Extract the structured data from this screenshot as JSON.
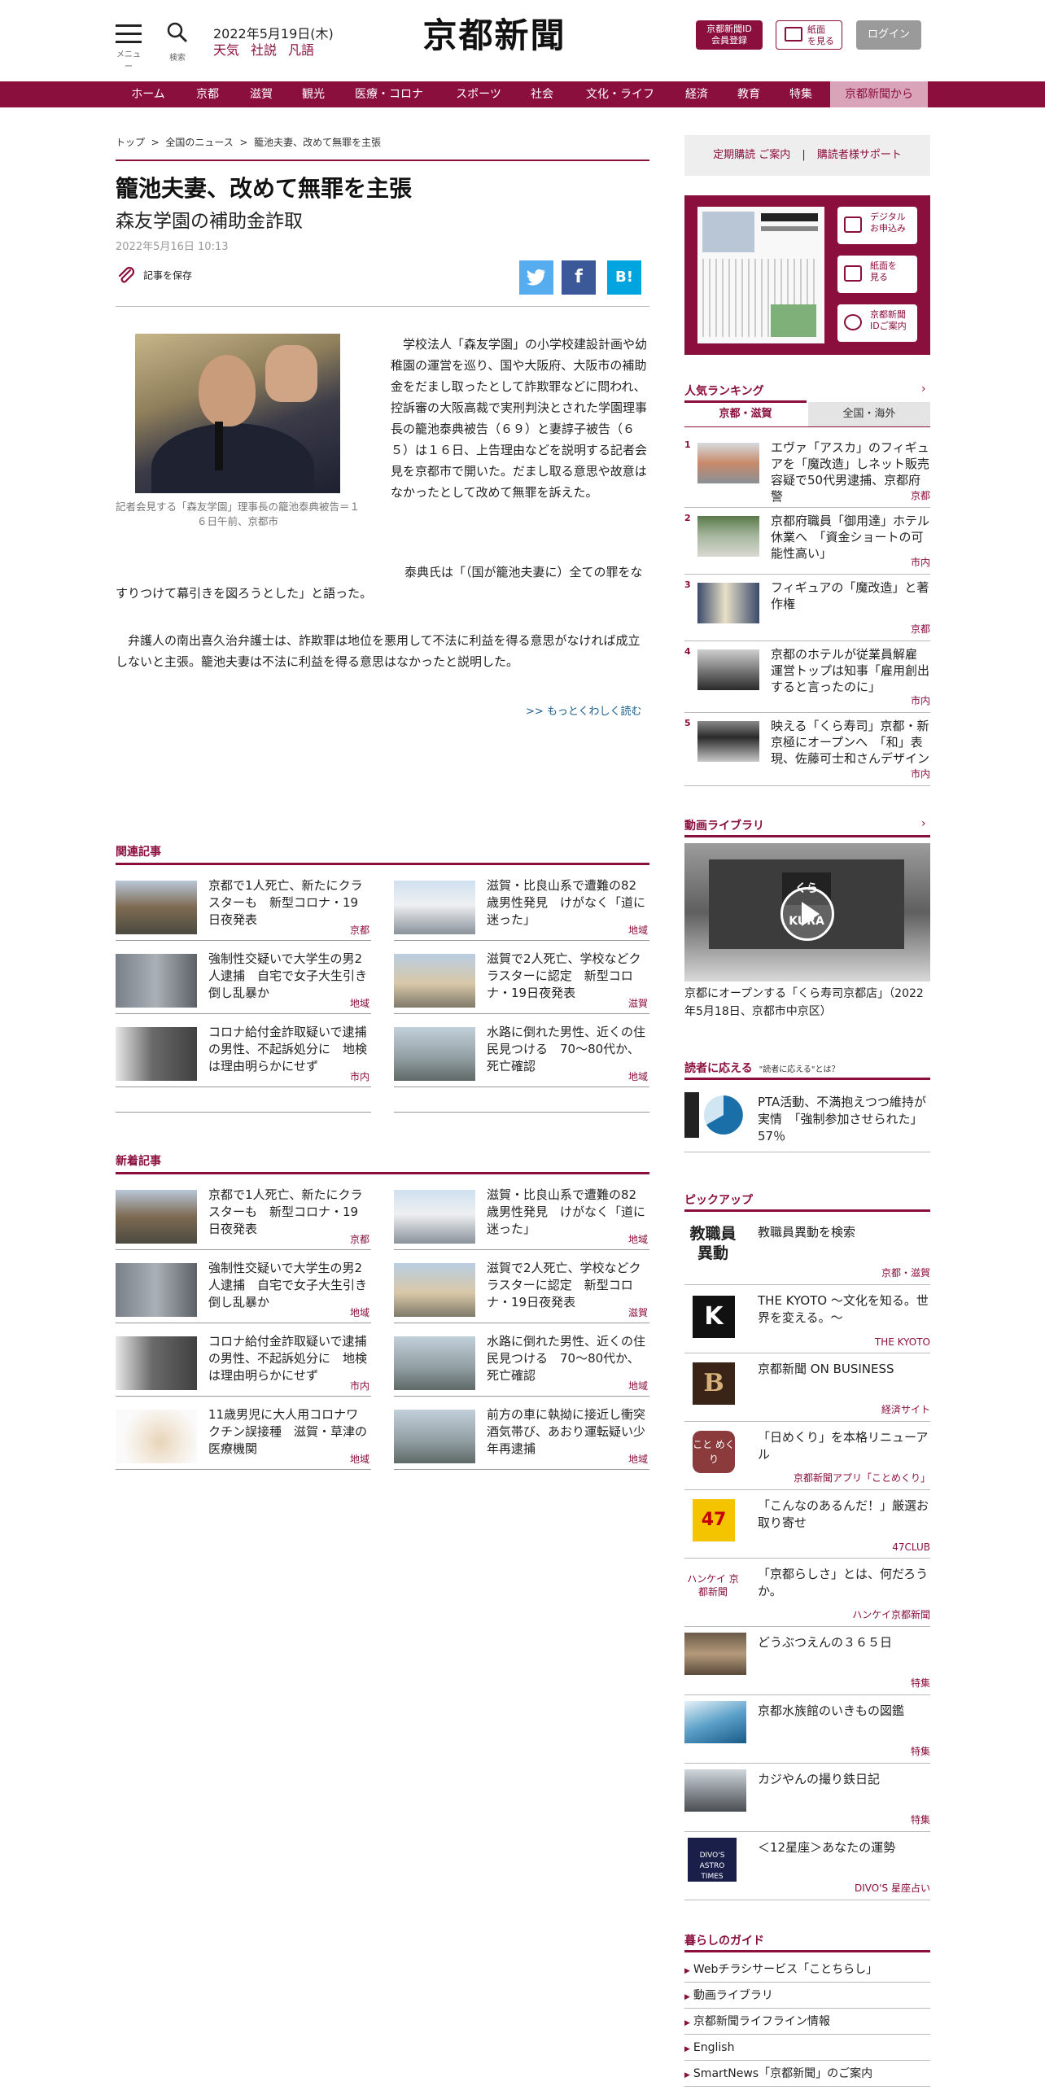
{
  "header": {
    "menu_label": "メニュー",
    "search_label": "検索",
    "date": "2022年5月19日(木)",
    "links": [
      "天気",
      "社説",
      "凡語"
    ],
    "logo": "京都新聞",
    "id_button": [
      "京都新聞ID",
      "会員登録"
    ],
    "paper_button": [
      "紙面",
      "を見る"
    ],
    "login": "ログイン"
  },
  "nav": [
    "ホーム",
    "京都",
    "滋賀",
    "観光",
    "医療・コロナ",
    "スポーツ",
    "社会",
    "文化・ライフ",
    "経済",
    "教育",
    "特集",
    "京都新聞から"
  ],
  "breadcrumb": [
    "トップ",
    "全国のニュース",
    "籠池夫妻、改めて無罪を主張"
  ],
  "article": {
    "title": "籠池夫妻、改めて無罪を主張",
    "subtitle": "森友学園の補助金詐取",
    "timestamp": "2022年5月16日 10:13",
    "save_label": "記事を保存",
    "photo_caption": "記者会見する「森友学園」理事長の籠池泰典被告＝１６日午前、京都市",
    "p1": "　学校法人「森友学園」の小学校建設計画や幼稚園の運営を巡り、国や大阪府、大阪市の補助金をだまし取ったとして詐欺罪などに問われ、控訴審の大阪高裁で実刑判決とされた学園理事長の籠池泰典被告（６９）と妻諄子被告（６５）は１６日、上告理由などを説明する記者会見を京都市で開いた。だまし取る意思や故意はなかったとして改めて無罪を訴えた。",
    "p2": "　泰典氏は「（国が籠池夫妻に）全ての罪をなすりつけて幕引きを図ろうとした」と語った。",
    "p3": "　弁護人の南出喜久治弁護士は、詐欺罪は地位を悪用して不法に利益を得る意思がなければ成立しないと主張。籠池夫妻は不法に利益を得る意思はなかったと説明した。",
    "read_more": ">> もっとくわしく読む"
  },
  "related": {
    "title": "関連記事",
    "items": [
      {
        "text": "京都で1人死亡、新たにクラスターも　新型コロナ・19日夜発表",
        "tag": "京都"
      },
      {
        "text": "滋賀・比良山系で遭難の82歳男性発見　けがなく「道に迷った」",
        "tag": "地域"
      },
      {
        "text": "強制性交疑いで大学生の男2人逮捕　自宅で女子大生引き倒し乱暴か",
        "tag": "地域"
      },
      {
        "text": "滋賀で2人死亡、学校などクラスターに認定　新型コロナ・19日夜発表",
        "tag": "滋賀"
      },
      {
        "text": "コロナ給付金詐取疑いで逮捕の男性、不起訴処分に　地検は理由明らかにせず",
        "tag": "市内"
      },
      {
        "text": "水路に倒れた男性、近くの住民見つける　70～80代か、死亡確認",
        "tag": "地域"
      }
    ]
  },
  "latest": {
    "title": "新着記事",
    "items": [
      {
        "text": "京都で1人死亡、新たにクラスターも　新型コロナ・19日夜発表",
        "tag": "京都"
      },
      {
        "text": "滋賀・比良山系で遭難の82歳男性発見　けがなく「道に迷った」",
        "tag": "地域"
      },
      {
        "text": "強制性交疑いで大学生の男2人逮捕　自宅で女子大生引き倒し乱暴か",
        "tag": "地域"
      },
      {
        "text": "滋賀で2人死亡、学校などクラスターに認定　新型コロナ・19日夜発表",
        "tag": "滋賀"
      },
      {
        "text": "コロナ給付金詐取疑いで逮捕の男性、不起訴処分に　地検は理由明らかにせず",
        "tag": "市内"
      },
      {
        "text": "水路に倒れた男性、近くの住民見つける　70～80代か、死亡確認",
        "tag": "地域"
      },
      {
        "text": "11歳男児に大人用コロナワクチン誤接種　滋賀・草津の医療機関",
        "tag": "地域"
      },
      {
        "text": "前方の車に執拗に接近し衝突　酒気帯び、あおり運転疑い少年再逮捕",
        "tag": "地域"
      }
    ]
  },
  "sidebar": {
    "sub_links": [
      "定期購読 ご案内",
      "|",
      "購読者様サポート"
    ],
    "paper_buttons": [
      [
        "デジタル",
        "お申込み"
      ],
      [
        "紙面を",
        "見る"
      ],
      [
        "京都新聞",
        "IDご案内"
      ]
    ],
    "ranking_title": "人気ランキング",
    "ranking_more": "›",
    "ranking_tabs": [
      "京都・滋賀",
      "全国・海外"
    ],
    "ranking": [
      {
        "no": "1",
        "text": "エヴァ「アスカ」のフィギュアを「魔改造」しネット販売　容疑で50代男逮捕、京都府警",
        "tag": "京都"
      },
      {
        "no": "2",
        "text": "京都府職員「御用達」ホテル休業へ　「資金ショートの可能性高い」",
        "tag": "市内"
      },
      {
        "no": "3",
        "text": "フィギュアの「魔改造」と著作権",
        "tag": "京都"
      },
      {
        "no": "4",
        "text": "京都のホテルが従業員解雇　運営トップは知事「雇用創出すると言ったのに」",
        "tag": "市内"
      },
      {
        "no": "5",
        "text": "映える「くら寿司」京都・新京極にオープンへ　「和」表現、佐藤可士和さんデザイン",
        "tag": "市内"
      }
    ],
    "video_title": "動画ライブラリ",
    "video_more": "›",
    "video_sign": "くら KURA",
    "video_caption": "京都にオープンする「くら寿司京都店」（2022年5月18日、京都市中京区）",
    "reader_title": "読者に応える",
    "reader_sub": "\"読者に応える\"とは？",
    "reader_item": "PTA活動、不満抱えつつ維持が実情　「強制参加させられた」57％",
    "pickup_title": "ピックアップ",
    "pickups": [
      {
        "logo": "教職員異動",
        "text": "教職員異動を検索",
        "tag": "京都・滋賀"
      },
      {
        "logo": "K",
        "text": "THE KYOTO ～文化を知る。世界を変える。～",
        "tag": "THE KYOTO"
      },
      {
        "logo": "B",
        "text": "京都新聞 ON BUSINESS",
        "tag": "経済サイト"
      },
      {
        "logo": "こと めくり",
        "text": "「日めくり」を本格リニューアル",
        "tag": "京都新聞アプリ「ことめくり」"
      },
      {
        "logo": "47",
        "text": "「こんなのあるんだ！」厳選お取り寄せ",
        "tag": "47CLUB"
      },
      {
        "logo": "ハンケイ 京都新聞",
        "text": "「京都らしさ」とは、何だろうか。",
        "tag": "ハンケイ京都新聞"
      },
      {
        "logo": "",
        "text": "どうぶつえんの３６５日",
        "tag": "特集"
      },
      {
        "logo": "",
        "text": "京都水族館のいきもの図鑑",
        "tag": "特集"
      },
      {
        "logo": "",
        "text": "カジやんの撮り鉄日記",
        "tag": "特集"
      },
      {
        "logo": "DIVO'S ASTRO TIMES",
        "text": "＜12星座＞あなたの運勢",
        "tag": "DIVO'S 星座占い"
      }
    ],
    "guide_title": "暮らしのガイド",
    "guides": [
      "Webチラシサービス「ことちらし」",
      "動画ライブラリ",
      "京都新聞ライフライン情報",
      "English",
      "SmartNews「京都新聞」のご案内"
    ]
  },
  "colors": {
    "brand": "#8b0f3c",
    "nav_active_bg": "#d9a3b8",
    "twitter": "#55acee",
    "facebook": "#3b5998",
    "hatena": "#00a4de"
  }
}
